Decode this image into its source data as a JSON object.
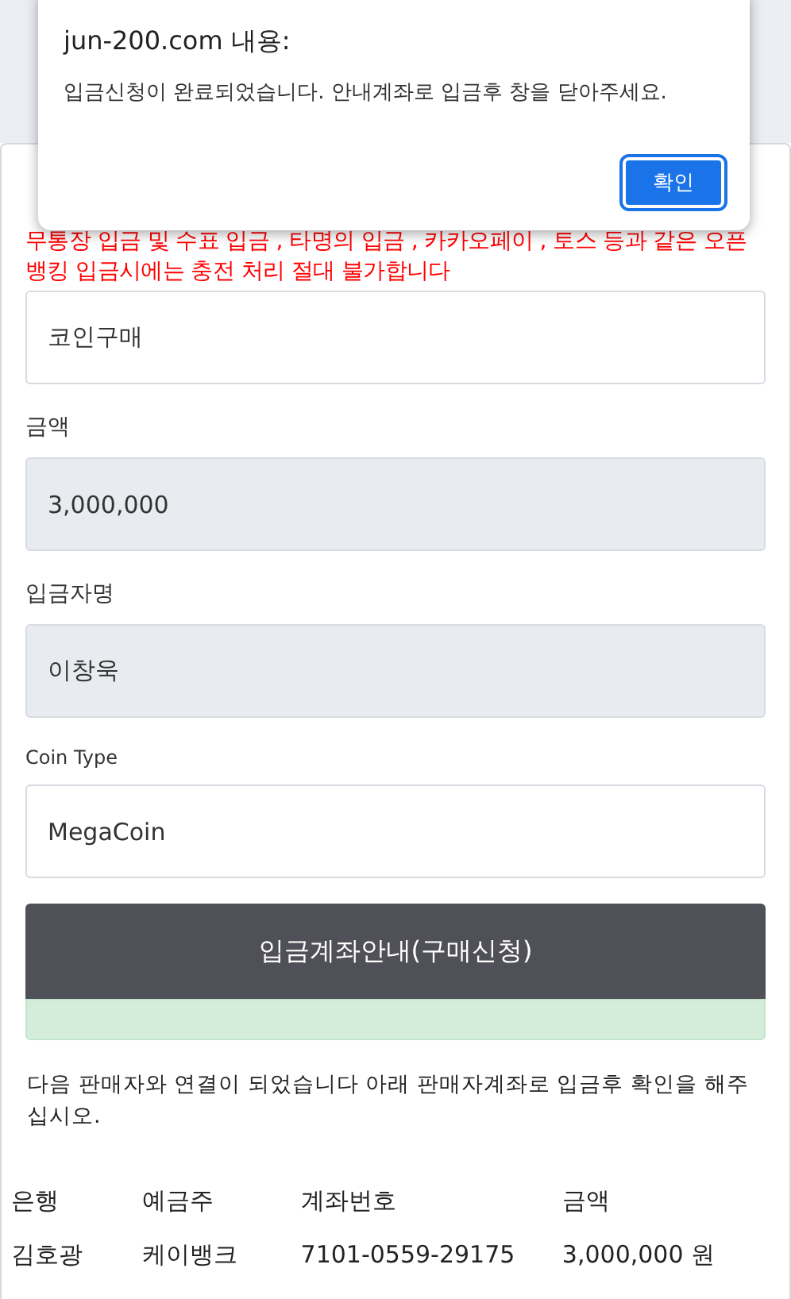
{
  "dialog": {
    "title": "jun-200.com 내용:",
    "message": "입금신청이 완료되었습니다. 안내계좌로 입금후 창을 닫아주세요.",
    "button": "확인"
  },
  "form": {
    "warning": "무통장 입금 및 수표 입금 , 타명의 입금 , 카카오페이 , 토스 등과 같은 오픈뱅킹 입금시에는 충전 처리 절대 불가합니다",
    "fields": [
      {
        "value": "코인구매",
        "readonly": false
      },
      {
        "label": "금액",
        "value": "3,000,000",
        "readonly": true
      },
      {
        "label": "입금자명",
        "value": "이창욱",
        "readonly": true
      },
      {
        "label": "Coin Type",
        "value": "MegaCoin",
        "readonly": false
      }
    ],
    "submit": "입금계좌안내(구매신청)"
  },
  "notice": "다음 판매자와 연결이 되었습니다 아래 판매자계좌로 입금후 확인을 해주십시오.",
  "table": {
    "columns": [
      "은행",
      "예금주",
      "계좌번호",
      "금액"
    ],
    "rows": [
      [
        "김호광",
        "케이뱅크",
        "7101-0559-29175",
        "3,000,000 원"
      ]
    ]
  }
}
